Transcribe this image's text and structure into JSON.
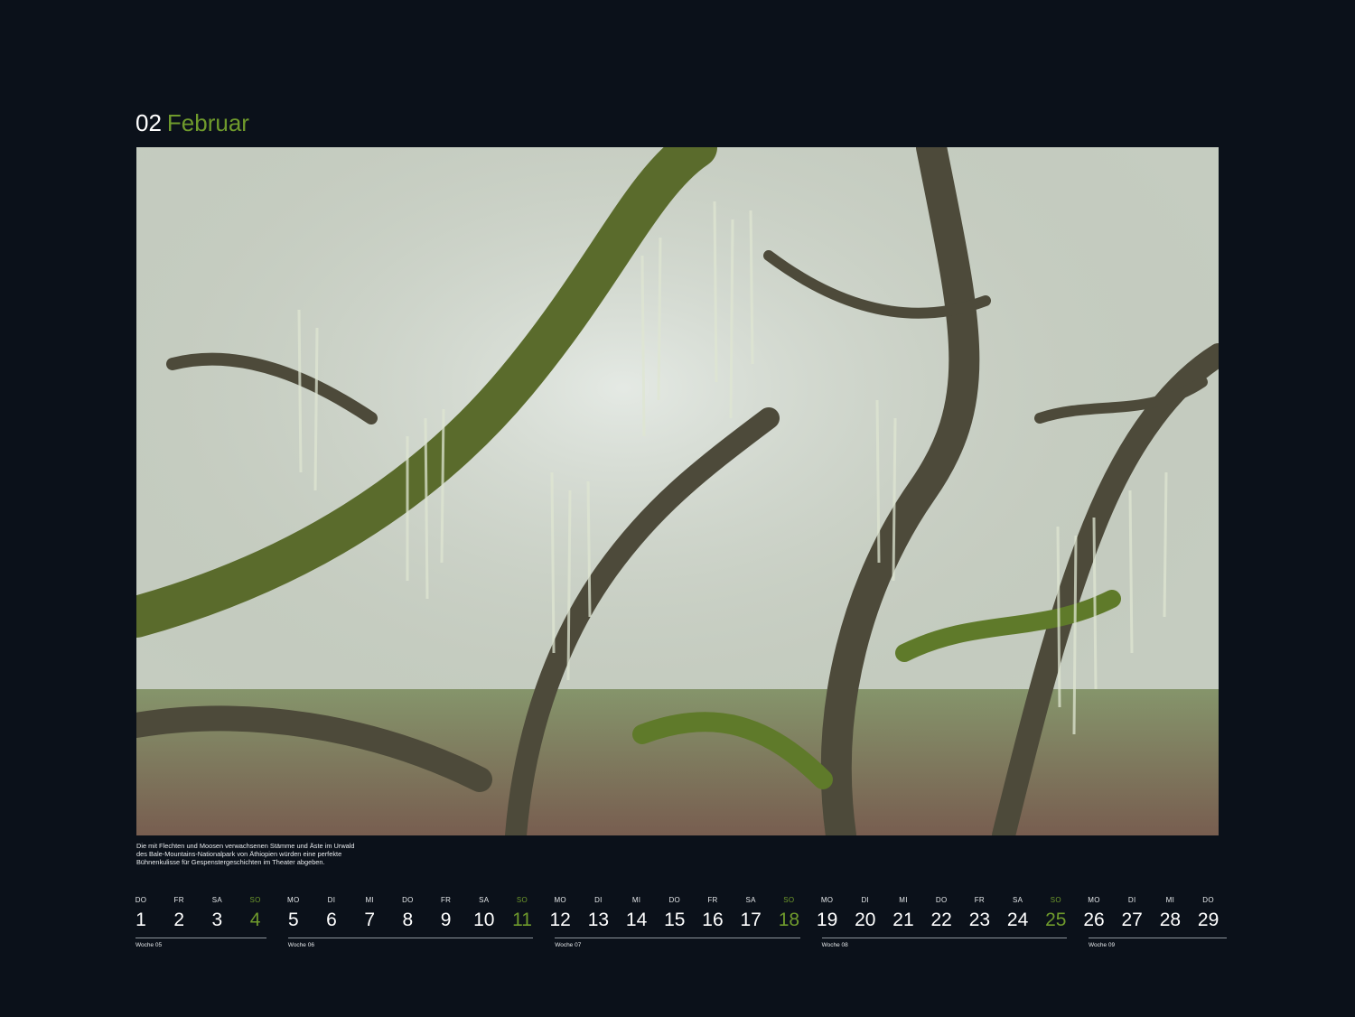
{
  "header": {
    "month_number": "02",
    "month_name": "Februar"
  },
  "photo": {
    "icon": "forest-photo"
  },
  "caption": {
    "lines": [
      "Die mit Flechten und Moosen verwachsenen Stämme und Äste im Urwald",
      "des Bale-Mountains-Nationalpark von Äthiopien würden eine perfekte",
      "Bühnenkulisse für Gespenstergeschichten im Theater abgeben."
    ]
  },
  "colors": {
    "accent": "#6f9a2c",
    "background": "#0b111a"
  },
  "weeks": [
    {
      "label": "Woche 05",
      "days": [
        {
          "name": "DO",
          "date": "1"
        },
        {
          "name": "FR",
          "date": "2"
        },
        {
          "name": "SA",
          "date": "3"
        },
        {
          "name": "SO",
          "date": "4"
        }
      ]
    },
    {
      "label": "Woche 06",
      "days": [
        {
          "name": "MO",
          "date": "5"
        },
        {
          "name": "DI",
          "date": "6"
        },
        {
          "name": "MI",
          "date": "7"
        },
        {
          "name": "DO",
          "date": "8"
        },
        {
          "name": "FR",
          "date": "9"
        },
        {
          "name": "SA",
          "date": "10"
        },
        {
          "name": "SO",
          "date": "11"
        }
      ]
    },
    {
      "label": "Woche 07",
      "days": [
        {
          "name": "MO",
          "date": "12"
        },
        {
          "name": "DI",
          "date": "13"
        },
        {
          "name": "MI",
          "date": "14"
        },
        {
          "name": "DO",
          "date": "15"
        },
        {
          "name": "FR",
          "date": "16"
        },
        {
          "name": "SA",
          "date": "17"
        },
        {
          "name": "SO",
          "date": "18"
        }
      ]
    },
    {
      "label": "Woche 08",
      "days": [
        {
          "name": "MO",
          "date": "19"
        },
        {
          "name": "DI",
          "date": "20"
        },
        {
          "name": "MI",
          "date": "21"
        },
        {
          "name": "DO",
          "date": "22"
        },
        {
          "name": "FR",
          "date": "23"
        },
        {
          "name": "SA",
          "date": "24"
        },
        {
          "name": "SO",
          "date": "25"
        }
      ]
    },
    {
      "label": "Woche 09",
      "days": [
        {
          "name": "MO",
          "date": "26"
        },
        {
          "name": "DI",
          "date": "27"
        },
        {
          "name": "MI",
          "date": "28"
        },
        {
          "name": "DO",
          "date": "29"
        }
      ]
    }
  ]
}
